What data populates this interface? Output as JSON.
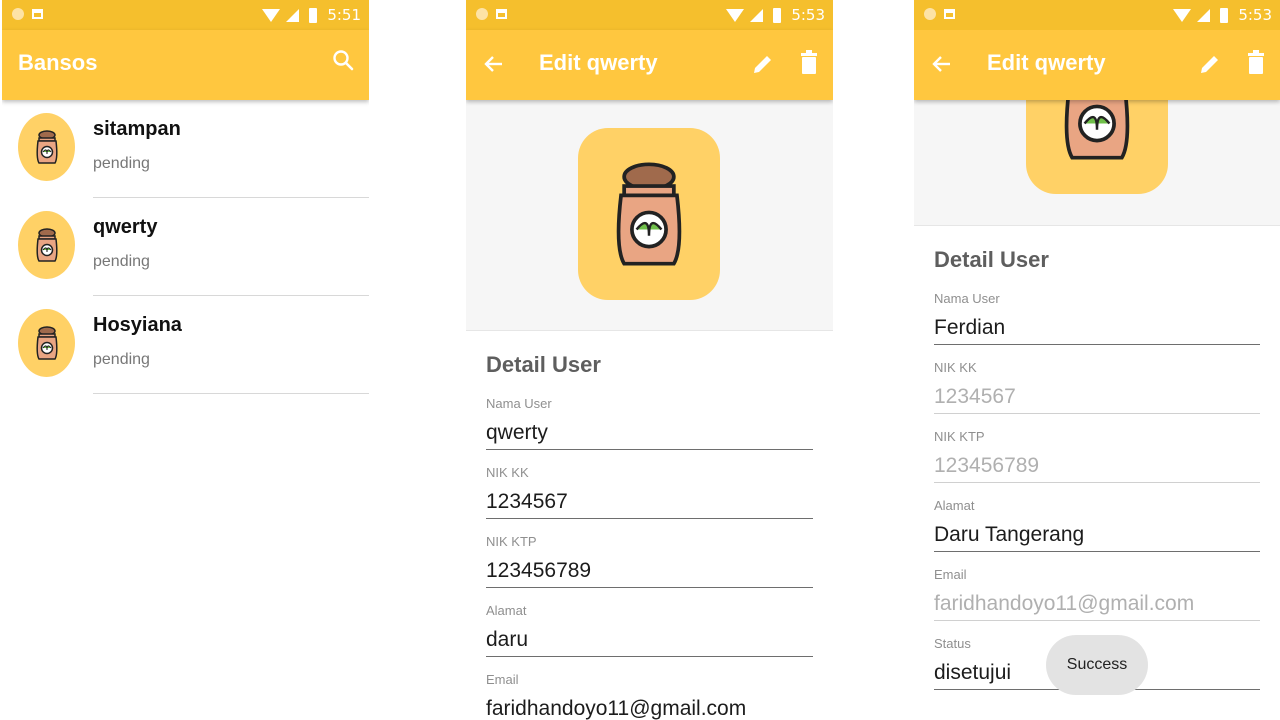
{
  "screens": [
    {
      "status": {
        "time": "5:51"
      },
      "appbar": {
        "title": "Bansos",
        "icon": "search-icon"
      },
      "items": [
        {
          "name": "sitampan",
          "status": "pending"
        },
        {
          "name": "qwerty",
          "status": "pending"
        },
        {
          "name": "Hosyiana",
          "status": "pending"
        }
      ]
    },
    {
      "status": {
        "time": "5:53"
      },
      "appbar": {
        "title": "Edit qwerty",
        "icons": [
          "back-arrow-icon",
          "edit-pencil-icon",
          "delete-trash-icon"
        ]
      },
      "section_title": "Detail User",
      "fields": [
        {
          "label": "Nama User",
          "value": "qwerty"
        },
        {
          "label": "NIK KK",
          "value": "1234567"
        },
        {
          "label": "NIK KTP",
          "value": "123456789"
        },
        {
          "label": "Alamat",
          "value": "daru"
        },
        {
          "label": "Email",
          "value": "faridhandoyo11@gmail.com"
        }
      ]
    },
    {
      "status": {
        "time": "5:53"
      },
      "appbar": {
        "title": "Edit qwerty",
        "icons": [
          "back-arrow-icon",
          "edit-pencil-icon",
          "delete-trash-icon"
        ]
      },
      "section_title": "Detail User",
      "fields": [
        {
          "label": "Nama User",
          "value": "Ferdian",
          "enabled": true
        },
        {
          "label": "NIK KK",
          "value": "1234567",
          "enabled": false
        },
        {
          "label": "NIK KTP",
          "value": "123456789",
          "enabled": false
        },
        {
          "label": "Alamat",
          "value": "Daru Tangerang",
          "enabled": true
        },
        {
          "label": "Email",
          "value": "faridhandoyo11@gmail.com",
          "enabled": false
        },
        {
          "label": "Status",
          "value": "disetujui",
          "enabled": true
        }
      ],
      "toast": "Success"
    }
  ],
  "colors": {
    "status_bar": "#f5bf2d",
    "app_bar": "#ffc73f",
    "avatar_bg": "#ffd166"
  }
}
